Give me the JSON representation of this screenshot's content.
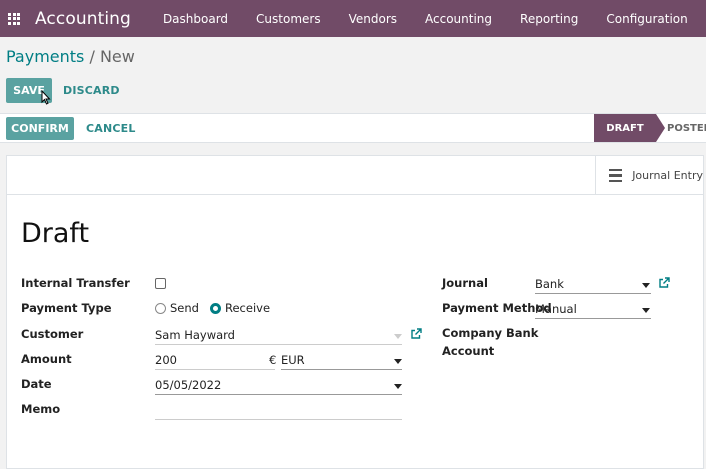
{
  "navbar": {
    "brand": "Accounting",
    "menu": [
      "Dashboard",
      "Customers",
      "Vendors",
      "Accounting",
      "Reporting",
      "Configuration"
    ]
  },
  "breadcrumb": {
    "parent": "Payments",
    "separator": " / ",
    "current": "New"
  },
  "toolbar": {
    "save_label": "SAVE",
    "discard_label": "DISCARD"
  },
  "statusbar": {
    "confirm_label": "CONFIRM",
    "cancel_label": "CANCEL",
    "stages": [
      "DRAFT",
      "POSTED"
    ],
    "active_stage": "DRAFT"
  },
  "smart_buttons": {
    "journal_entry": "Journal Entry"
  },
  "form": {
    "title": "Draft",
    "internal_transfer": {
      "label": "Internal Transfer",
      "checked": false
    },
    "payment_type": {
      "label": "Payment Type",
      "options": [
        "Send",
        "Receive"
      ],
      "selected": "Receive"
    },
    "customer": {
      "label": "Customer",
      "value": "Sam Hayward"
    },
    "amount": {
      "label": "Amount",
      "value": "200",
      "currency_symbol": "€",
      "currency": "EUR"
    },
    "date": {
      "label": "Date",
      "value": "05/05/2022"
    },
    "memo": {
      "label": "Memo",
      "value": ""
    },
    "journal": {
      "label": "Journal",
      "value": "Bank"
    },
    "payment_method": {
      "label": "Payment Method",
      "value": "Manual"
    },
    "company_bank_account": {
      "label_line1": "Company Bank",
      "label_line2": "Account"
    }
  },
  "colors": {
    "navbar": "#714b67",
    "primary_button": "#5aa2a1",
    "link": "#017e84"
  }
}
